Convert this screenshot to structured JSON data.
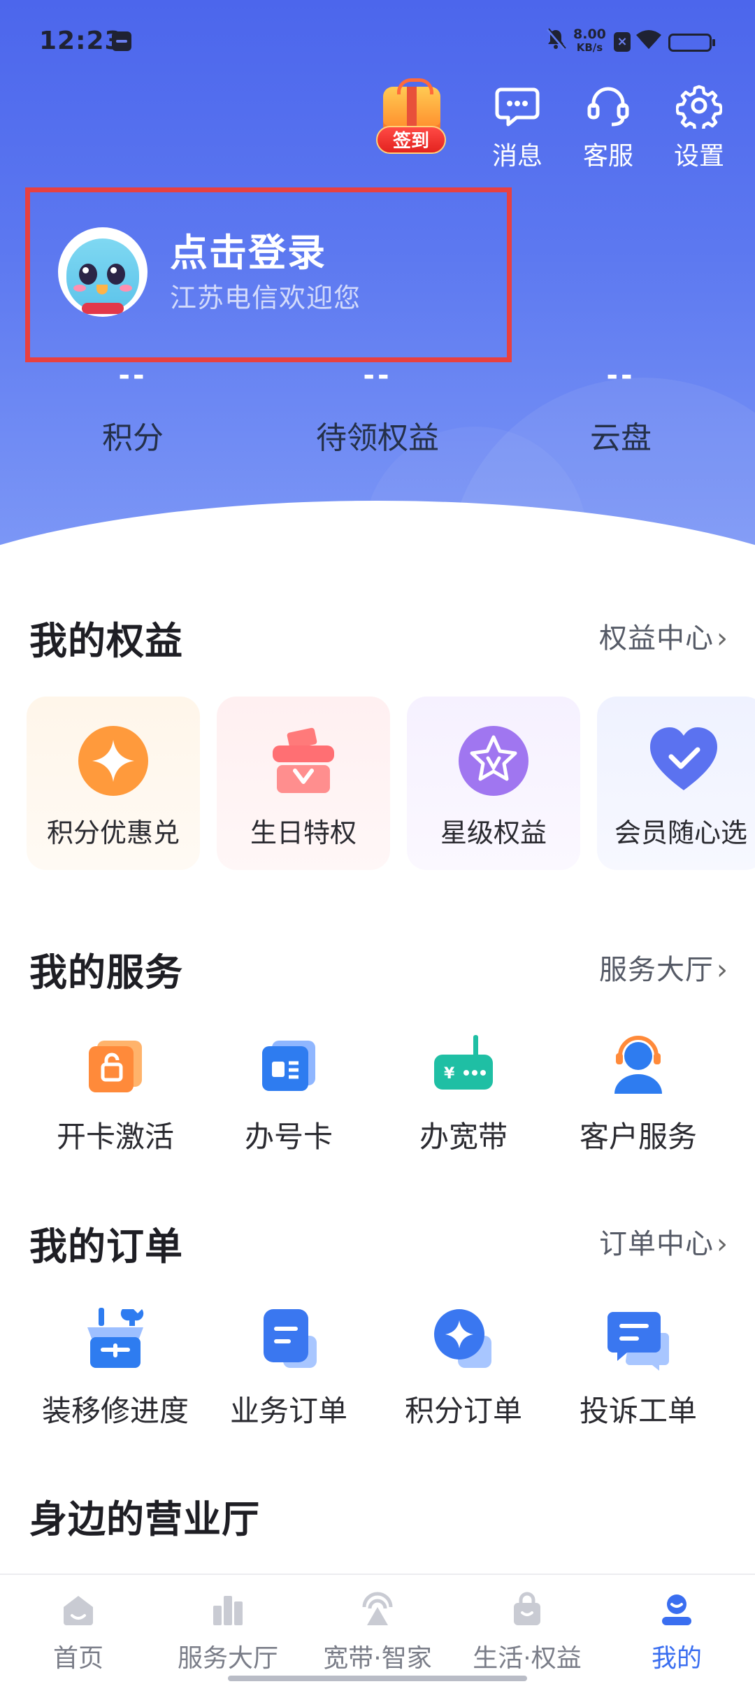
{
  "status_bar": {
    "time": "12:23",
    "net_speed_value": "8.00",
    "net_speed_unit": "KB/s",
    "battery_level": 1.0
  },
  "header": {
    "signin_label": "签到",
    "actions": [
      {
        "label": "消息",
        "icon": "message-icon"
      },
      {
        "label": "客服",
        "icon": "headset-icon"
      },
      {
        "label": "设置",
        "icon": "gear-icon"
      }
    ],
    "login": {
      "title": "点击登录",
      "subtitle": "江苏电信欢迎您"
    },
    "stats": [
      {
        "value": "--",
        "label": "积分"
      },
      {
        "value": "--",
        "label": "待领权益"
      },
      {
        "value": "--",
        "label": "云盘"
      }
    ]
  },
  "benefits": {
    "title": "我的权益",
    "link": "权益中心",
    "items": [
      {
        "label": "积分优惠兑",
        "icon": "points-star-icon"
      },
      {
        "label": "生日特权",
        "icon": "birthday-cake-icon"
      },
      {
        "label": "星级权益",
        "icon": "star-badge-icon"
      },
      {
        "label": "会员随心选",
        "icon": "heart-check-icon"
      }
    ]
  },
  "services": {
    "title": "我的服务",
    "link": "服务大厅",
    "items": [
      {
        "label": "开卡激活",
        "icon": "card-lock-icon"
      },
      {
        "label": "办号卡",
        "icon": "sim-card-icon"
      },
      {
        "label": "办宽带",
        "icon": "router-icon"
      },
      {
        "label": "客户服务",
        "icon": "customer-agent-icon"
      }
    ]
  },
  "orders": {
    "title": "我的订单",
    "link": "订单中心",
    "items": [
      {
        "label": "装移修进度",
        "icon": "toolbox-icon"
      },
      {
        "label": "业务订单",
        "icon": "order-doc-icon"
      },
      {
        "label": "积分订单",
        "icon": "points-order-icon"
      },
      {
        "label": "投诉工单",
        "icon": "complaint-chat-icon"
      }
    ]
  },
  "nearby": {
    "title": "身边的营业厅"
  },
  "bottom_nav": [
    {
      "label": "首页",
      "icon": "home-icon",
      "active": false
    },
    {
      "label": "服务大厅",
      "icon": "service-hall-icon",
      "active": false
    },
    {
      "label": "宽带·智家",
      "icon": "broadband-home-icon",
      "active": false
    },
    {
      "label": "生活·权益",
      "icon": "shopping-bag-icon",
      "active": false
    },
    {
      "label": "我的",
      "icon": "profile-icon",
      "active": true
    }
  ],
  "colors": {
    "header_gradient_top": "#4c66ec",
    "accent_blue": "#3a6ef0",
    "highlight_border": "#e84040"
  }
}
